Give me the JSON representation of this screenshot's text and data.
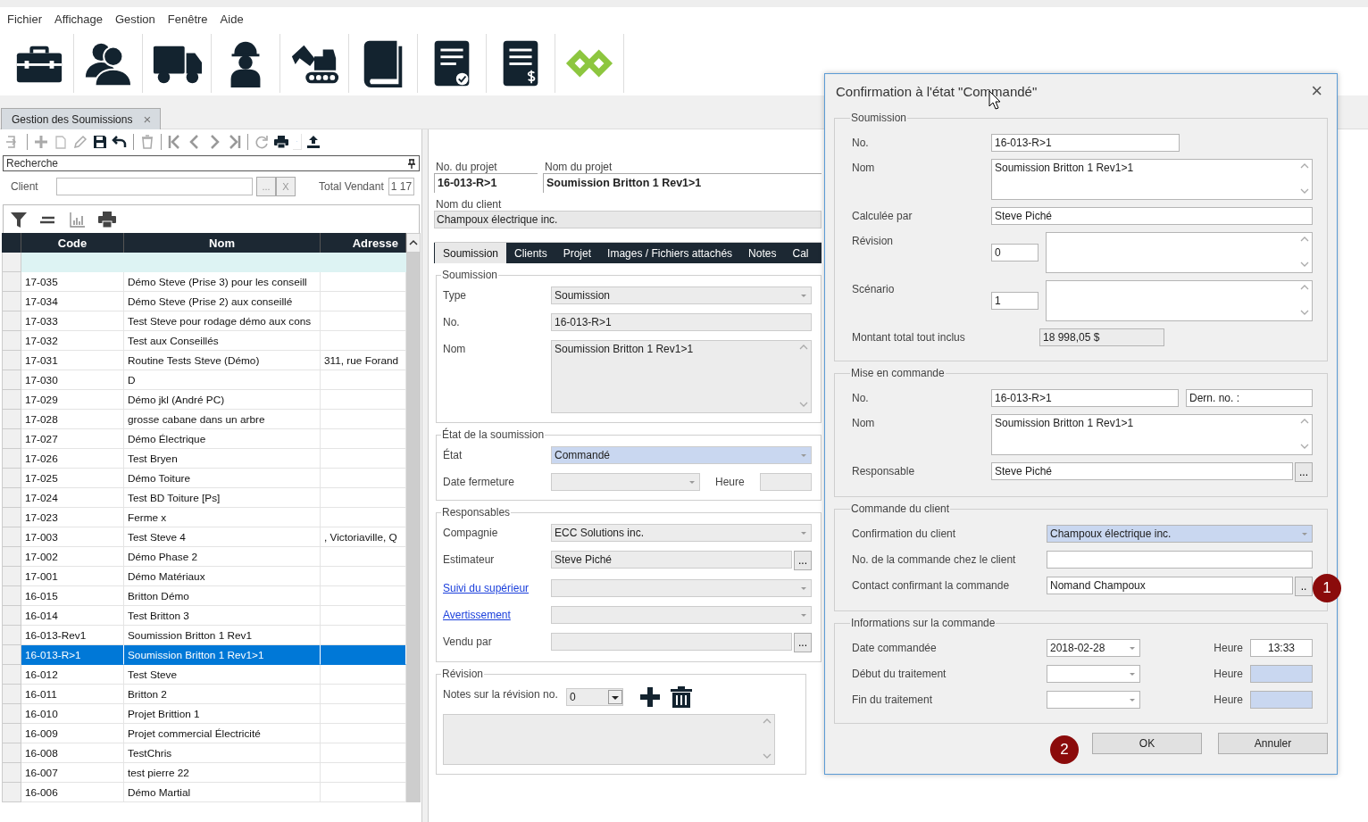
{
  "menu": [
    "Fichier",
    "Affichage",
    "Gestion",
    "Fenêtre",
    "Aide"
  ],
  "document_tabs": [
    {
      "label": "Gestion des Soumissions",
      "selected": true,
      "close": "×"
    }
  ],
  "left_panel": {
    "search": {
      "placeholder": "Recherche"
    },
    "client": {
      "label": "Client",
      "browse": "...",
      "clear": "X"
    },
    "total": {
      "label": "Total Vendant",
      "value": "1 17"
    },
    "table": {
      "columns": [
        "Code",
        "Nom",
        "Adresse"
      ],
      "rows": [
        {
          "code": "17-035",
          "nom": "Démo Steve (Prise 3) pour les conseill",
          "selected": false
        },
        {
          "code": "17-034",
          "nom": "Démo Steve (Prise 2) aux conseillé",
          "selected": false
        },
        {
          "code": "17-033",
          "nom": "Test Steve pour rodage démo aux cons",
          "selected": false
        },
        {
          "code": "17-032",
          "nom": "Test aux Conseillés",
          "selected": false
        },
        {
          "code": "17-031",
          "nom": "Routine Tests Steve (Démo)",
          "adresse": "311, rue Forand",
          "selected": false
        },
        {
          "code": "17-030",
          "nom": "D",
          "selected": false
        },
        {
          "code": "17-029",
          "nom": "Démo jkl (André PC)",
          "selected": false
        },
        {
          "code": "17-028",
          "nom": "grosse cabane dans un arbre",
          "selected": false
        },
        {
          "code": "17-027",
          "nom": "Démo Électrique",
          "selected": false
        },
        {
          "code": "17-026",
          "nom": "Test Bryen",
          "selected": false
        },
        {
          "code": "17-025",
          "nom": "Démo Toiture",
          "selected": false
        },
        {
          "code": "17-024",
          "nom": "Test BD Toiture [Ps]",
          "selected": false
        },
        {
          "code": "17-023",
          "nom": "Ferme x",
          "selected": false
        },
        {
          "code": "17-003",
          "nom": "Test Steve 4",
          "adresse": ", Victoriaville, Q",
          "selected": false
        },
        {
          "code": "17-002",
          "nom": "Démo Phase 2",
          "selected": false
        },
        {
          "code": "17-001",
          "nom": "Démo Matériaux",
          "selected": false
        },
        {
          "code": "16-015",
          "nom": "Britton Démo",
          "selected": false
        },
        {
          "code": "16-014",
          "nom": "Test Britton 3",
          "selected": false
        },
        {
          "code": "16-013-Rev1",
          "nom": "Soumission Britton 1 Rev1",
          "selected": false
        },
        {
          "code": "16-013-R>1",
          "nom": "Soumission Britton 1 Rev1>1",
          "selected": true
        },
        {
          "code": "16-012",
          "nom": "Test Steve",
          "selected": false
        },
        {
          "code": "16-011",
          "nom": "Britton 2",
          "selected": false
        },
        {
          "code": "16-010",
          "nom": "Projet Brittion 1",
          "selected": false
        },
        {
          "code": "16-009",
          "nom": "Projet commercial Électricité",
          "selected": false
        },
        {
          "code": "16-008",
          "nom": "TestChris",
          "selected": false
        },
        {
          "code": "16-007",
          "nom": "test pierre 22",
          "selected": false
        },
        {
          "code": "16-006",
          "nom": "Démo Martial",
          "selected": false
        }
      ]
    }
  },
  "project": {
    "no_label": "No. du projet",
    "no": "16-013-R>1",
    "name_label": "Nom du projet",
    "name": "Soumission Britton 1 Rev1>1",
    "client_label": "Nom du client",
    "client": "Champoux électrique inc."
  },
  "form_tabs": [
    {
      "label": "Soumission",
      "selected": true
    },
    {
      "label": "Clients",
      "selected": false
    },
    {
      "label": "Projet",
      "selected": false
    },
    {
      "label": "Images / Fichiers attachés",
      "selected": false
    },
    {
      "label": "Notes",
      "selected": false
    },
    {
      "label": "Cal",
      "selected": false
    }
  ],
  "form_groups": [
    {
      "title": "Soumission",
      "rows": [
        {
          "label": "Type",
          "kind": "label",
          "fields": [
            {
              "kind": "dropdown",
              "value": "Soumission",
              "highlighted": false
            }
          ]
        },
        {
          "label": "No.",
          "kind": "label",
          "fields": [
            {
              "kind": "text",
              "value": "16-013-R>1",
              "highlighted": false
            }
          ]
        },
        {
          "label": "Nom",
          "kind": "label",
          "fields": [
            {
              "kind": "textarea",
              "value": "Soumission Britton 1 Rev1>1",
              "highlighted": false
            }
          ]
        }
      ]
    },
    {
      "title": "État de la soumission",
      "rows": [
        {
          "label": "État",
          "kind": "label",
          "fields": [
            {
              "kind": "dropdown",
              "value": "Commandé",
              "highlighted": true
            }
          ]
        },
        {
          "label": "Date fermeture",
          "kind": "label",
          "fields": [
            {
              "kind": "date",
              "highlighted": false
            },
            {
              "kind": "label",
              "value": "Heure"
            },
            {
              "kind": "text",
              "highlighted": false
            }
          ]
        }
      ]
    },
    {
      "title": "Responsables",
      "rows": [
        {
          "label": "Compagnie",
          "kind": "label",
          "fields": [
            {
              "kind": "dropdown",
              "value": "ECC Solutions inc.",
              "highlighted": false
            }
          ]
        },
        {
          "label": "Estimateur",
          "kind": "label",
          "fields": [
            {
              "kind": "browse",
              "value": "Steve Piché",
              "button": "...",
              "highlighted": false
            }
          ]
        },
        {
          "label": "Suivi du supérieur",
          "kind": "link",
          "fields": [
            {
              "kind": "dropdown",
              "highlighted": false
            }
          ]
        },
        {
          "label": "Avertissement",
          "kind": "link",
          "fields": [
            {
              "kind": "dropdown",
              "highlighted": false
            }
          ]
        },
        {
          "label": "Vendu par",
          "kind": "label",
          "fields": [
            {
              "kind": "browse",
              "button": "...",
              "highlighted": false
            }
          ]
        }
      ]
    },
    {
      "title": "Révision",
      "rows": [
        {
          "label": "Notes sur la révision no.",
          "kind": "label",
          "fields": [
            {
              "kind": "select",
              "value": "0",
              "highlighted": false
            },
            {
              "kind": "actions"
            }
          ]
        },
        {
          "fields": [
            {
              "kind": "textarea",
              "highlighted": false
            }
          ]
        }
      ]
    }
  ],
  "dialog": {
    "title": "Confirmation à l'état \"Commandé\"",
    "close": "×",
    "groups": [
      {
        "title": "Soumission",
        "rows": [
          {
            "label": "No.",
            "fields": [
              {
                "kind": "id",
                "value": "16-013-R>1",
                "highlighted": false
              }
            ]
          },
          {
            "label": "Nom",
            "fields": [
              {
                "kind": "textarea",
                "value": "Soumission Britton 1 Rev1>1",
                "highlighted": false
              }
            ]
          },
          {
            "label": "Calculée par",
            "fields": [
              {
                "kind": "text",
                "value": "Steve Piché",
                "highlighted": false
              }
            ]
          },
          {
            "label": "Révision",
            "fields": [
              {
                "kind": "number",
                "value": "0",
                "highlighted": false
              },
              {
                "kind": "textarea",
                "highlighted": false
              }
            ]
          },
          {
            "label": "Scénario",
            "fields": [
              {
                "kind": "number",
                "value": "1",
                "highlighted": false
              },
              {
                "kind": "textarea",
                "highlighted": false
              }
            ]
          },
          {
            "label": "Montant total tout inclus",
            "fields": [
              {
                "kind": "amount",
                "value": "18 998,05 $",
                "highlighted": false
              }
            ]
          }
        ]
      },
      {
        "title": "Mise en commande",
        "rows": [
          {
            "label": "No.",
            "fields": [
              {
                "kind": "id",
                "value": "16-013-R>1",
                "highlighted": false
              },
              {
                "kind": "tag",
                "value": "Dern. no. :",
                "highlighted": false
              }
            ]
          },
          {
            "label": "Nom",
            "fields": [
              {
                "kind": "textarea",
                "value": "Soumission Britton 1 Rev1>1",
                "highlighted": false
              }
            ]
          },
          {
            "label": "Responsable",
            "fields": [
              {
                "kind": "browse",
                "value": "Steve Piché",
                "button": "...",
                "highlighted": false
              }
            ]
          }
        ]
      },
      {
        "title": "Commande du client",
        "rows": [
          {
            "label": "Confirmation du client",
            "fields": [
              {
                "kind": "dropdown",
                "value": "Champoux électrique inc.",
                "highlighted": true
              }
            ]
          },
          {
            "label": "No. de la commande chez le client",
            "fields": [
              {
                "kind": "text",
                "highlighted": false
              }
            ]
          },
          {
            "label": "Contact confirmant la commande",
            "fields": [
              {
                "kind": "browse",
                "value": "Nomand Champoux",
                "button": "..",
                "highlighted": false
              }
            ]
          }
        ]
      },
      {
        "title": "Informations sur la commande",
        "rows": [
          {
            "label": "Date commandée",
            "fields": [
              {
                "kind": "date",
                "value": "2018-02-28",
                "highlighted": false
              },
              {
                "kind": "label",
                "value": "Heure"
              },
              {
                "kind": "time",
                "value": "13:33",
                "highlighted": false
              }
            ]
          },
          {
            "label": "Début du traitement",
            "fields": [
              {
                "kind": "date",
                "highlighted": false
              },
              {
                "kind": "label",
                "value": "Heure"
              },
              {
                "kind": "time",
                "highlighted": true
              }
            ]
          },
          {
            "label": "Fin du traitement",
            "fields": [
              {
                "kind": "date",
                "highlighted": false
              },
              {
                "kind": "label",
                "value": "Heure"
              },
              {
                "kind": "time",
                "highlighted": true
              }
            ]
          }
        ]
      }
    ],
    "buttons": [
      {
        "label": "OK"
      },
      {
        "label": "Annuler"
      }
    ]
  },
  "annotations": [
    {
      "label": "1"
    },
    {
      "label": "2"
    }
  ]
}
